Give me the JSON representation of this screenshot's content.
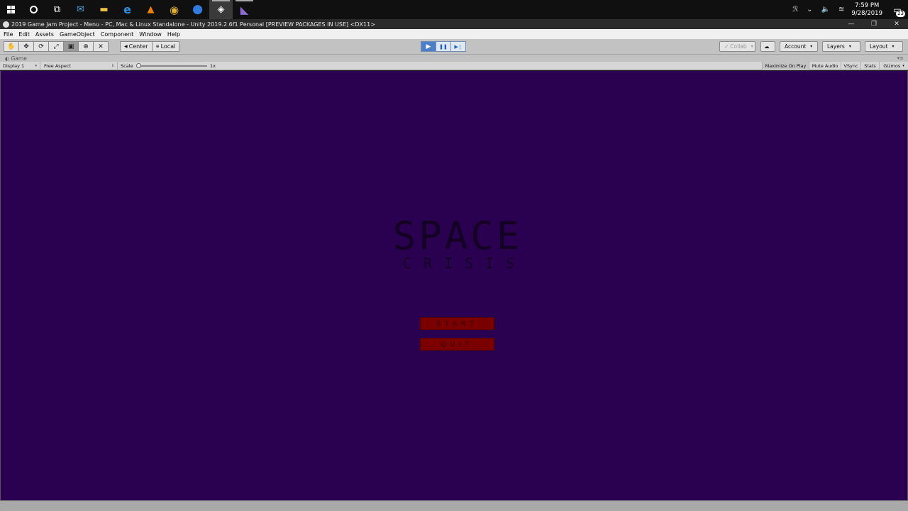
{
  "taskbar": {
    "apps": [
      {
        "name": "windows-start",
        "glyph": ""
      },
      {
        "name": "cortana",
        "glyph": ""
      },
      {
        "name": "task-view",
        "glyph": "⧉"
      },
      {
        "name": "mail",
        "glyph": "✉"
      },
      {
        "name": "file-explorer",
        "glyph": "▬"
      },
      {
        "name": "edge",
        "glyph": "e"
      },
      {
        "name": "vlc",
        "glyph": "▲"
      },
      {
        "name": "chrome",
        "glyph": "◉"
      },
      {
        "name": "maps",
        "glyph": "⬤"
      },
      {
        "name": "unity",
        "glyph": "◈"
      },
      {
        "name": "visual-studio",
        "glyph": "◣"
      }
    ],
    "tray": {
      "people_icon": "ℛ",
      "chevron": "⌄",
      "volume": "🔈",
      "wifi": "≋"
    },
    "time": "7:59 PM",
    "date": "9/28/2019",
    "notification_count": "23"
  },
  "window": {
    "title": "2019 Game Jam Project - Menu - PC, Mac & Linux Standalone - Unity 2019.2.6f1 Personal [PREVIEW PACKAGES IN USE] <DX11>",
    "minimize": "—",
    "restore": "❐",
    "close": "✕"
  },
  "menu": [
    "File",
    "Edit",
    "Assets",
    "GameObject",
    "Component",
    "Window",
    "Help"
  ],
  "toolbar": {
    "tools": [
      "✋",
      "✥",
      "⟳",
      "⤢",
      "▣",
      "⊕",
      "✕"
    ],
    "pivot_center": "Center",
    "pivot_local": "Local",
    "play": "▶",
    "pause": "❚❚",
    "step": "▶❘",
    "collab": "Collab",
    "account": "Account",
    "layers": "Layers",
    "layout": "Layout"
  },
  "game_panel": {
    "tab_label": "Game",
    "display": "Display 1",
    "aspect": "Free Aspect",
    "scale_label": "Scale",
    "scale_value": "1x",
    "maximize_on_play": "Maximize On Play",
    "mute_audio": "Mute Audio",
    "vsync": "VSync",
    "stats": "Stats",
    "gizmos": "Gizmos"
  },
  "game": {
    "logo_line1": "SPACE",
    "logo_line2": "CRISIS",
    "start_button": "START",
    "quit_button": "QUIT",
    "background_color": "#2a0051",
    "button_color": "#7a0000"
  }
}
